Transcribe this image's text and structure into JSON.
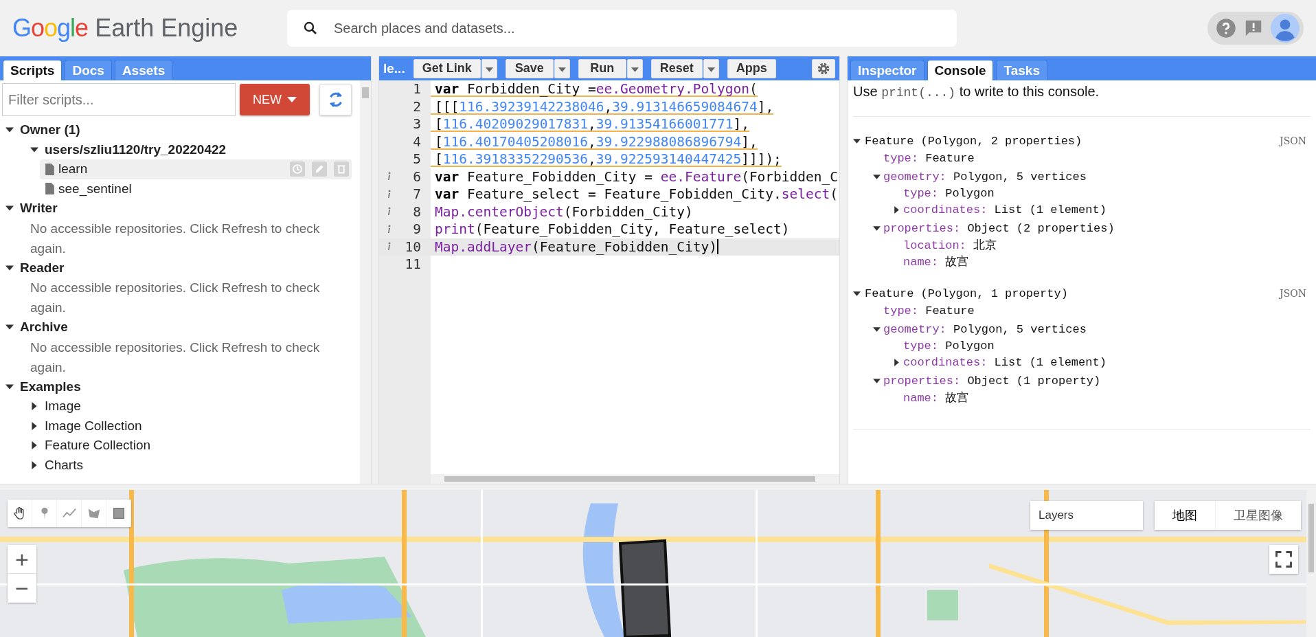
{
  "header": {
    "logo": {
      "brand": "Google",
      "product": "Earth Engine"
    },
    "search": {
      "placeholder": "Search places and datasets..."
    }
  },
  "left_panel": {
    "tabs": [
      {
        "label": "Scripts",
        "selected": true
      },
      {
        "label": "Docs",
        "selected": false
      },
      {
        "label": "Assets",
        "selected": false
      }
    ],
    "filter": {
      "placeholder": "Filter scripts..."
    },
    "new_button": "NEW",
    "tree": [
      {
        "label": "Owner (1)",
        "expanded": true,
        "children": [
          {
            "label": "users/szliu1120/try_20220422",
            "expanded": true,
            "children": [
              {
                "label": "learn",
                "kind": "file",
                "selected": true
              },
              {
                "label": "see_sentinel",
                "kind": "file",
                "selected": false
              }
            ]
          }
        ]
      },
      {
        "label": "Writer",
        "expanded": true,
        "message": "No accessible repositories. Click Refresh to check again."
      },
      {
        "label": "Reader",
        "expanded": true,
        "message": "No accessible repositories. Click Refresh to check again."
      },
      {
        "label": "Archive",
        "expanded": true,
        "message": "No accessible repositories. Click Refresh to check again."
      },
      {
        "label": "Examples",
        "expanded": true,
        "children": [
          {
            "label": "Image",
            "kind": "folder",
            "expanded": false
          },
          {
            "label": "Image Collection",
            "kind": "folder",
            "expanded": false
          },
          {
            "label": "Feature Collection",
            "kind": "folder",
            "expanded": false
          },
          {
            "label": "Charts",
            "kind": "folder",
            "expanded": false
          }
        ]
      }
    ]
  },
  "editor": {
    "title": "le...",
    "buttons": [
      {
        "label": "Get Link",
        "dropdown": true
      },
      {
        "label": "Save",
        "dropdown": true
      },
      {
        "label": "Run",
        "dropdown": true
      },
      {
        "label": "Reset",
        "dropdown": true
      },
      {
        "label": "Apps",
        "dropdown": false
      }
    ],
    "lines": [
      {
        "number": "1",
        "warning": true,
        "info": false,
        "current": false,
        "tokens": [
          {
            "kind": "kw",
            "text": "var"
          },
          {
            "kind": "plain",
            "text": " Forbidden_City ="
          },
          {
            "kind": "fn",
            "text": "ee.Geometry.Polygon"
          },
          {
            "kind": "plain",
            "text": "("
          }
        ]
      },
      {
        "number": "2",
        "warning": true,
        "info": false,
        "current": false,
        "tokens": [
          {
            "kind": "plain",
            "text": "[[["
          },
          {
            "kind": "num",
            "text": "116.39239142238046"
          },
          {
            "kind": "plain",
            "text": ","
          },
          {
            "kind": "num",
            "text": "39.913146659084674"
          },
          {
            "kind": "plain",
            "text": "],"
          }
        ]
      },
      {
        "number": "3",
        "warning": true,
        "info": false,
        "current": false,
        "tokens": [
          {
            "kind": "plain",
            "text": "["
          },
          {
            "kind": "num",
            "text": "116.40209029017831"
          },
          {
            "kind": "plain",
            "text": ","
          },
          {
            "kind": "num",
            "text": "39.91354166001771"
          },
          {
            "kind": "plain",
            "text": "],"
          }
        ]
      },
      {
        "number": "4",
        "warning": true,
        "info": false,
        "current": false,
        "tokens": [
          {
            "kind": "plain",
            "text": "["
          },
          {
            "kind": "num",
            "text": "116.40170405208016"
          },
          {
            "kind": "plain",
            "text": ","
          },
          {
            "kind": "num",
            "text": "39.922988086896794"
          },
          {
            "kind": "plain",
            "text": "],"
          }
        ]
      },
      {
        "number": "5",
        "warning": true,
        "info": false,
        "current": false,
        "tokens": [
          {
            "kind": "plain",
            "text": "["
          },
          {
            "kind": "num",
            "text": "116.39183352290536"
          },
          {
            "kind": "plain",
            "text": ","
          },
          {
            "kind": "num",
            "text": "39.922593140447425"
          },
          {
            "kind": "plain",
            "text": "]]]);"
          }
        ]
      },
      {
        "number": "6",
        "warning": false,
        "info": true,
        "current": false,
        "tokens": [
          {
            "kind": "kw",
            "text": "var"
          },
          {
            "kind": "plain",
            "text": " Feature_Fobidden_City = "
          },
          {
            "kind": "fn",
            "text": "ee.Feature"
          },
          {
            "kind": "plain",
            "text": "(Forbidden_C"
          }
        ]
      },
      {
        "number": "7",
        "warning": false,
        "info": true,
        "current": false,
        "tokens": [
          {
            "kind": "kw",
            "text": "var"
          },
          {
            "kind": "plain",
            "text": " Feature_select = Feature_Fobidden_City."
          },
          {
            "kind": "fn",
            "text": "select"
          },
          {
            "kind": "plain",
            "text": "("
          }
        ]
      },
      {
        "number": "8",
        "warning": false,
        "info": true,
        "current": false,
        "tokens": [
          {
            "kind": "fn",
            "text": "Map.centerObject"
          },
          {
            "kind": "plain",
            "text": "(Forbidden_City)"
          }
        ]
      },
      {
        "number": "9",
        "warning": false,
        "info": true,
        "current": false,
        "tokens": [
          {
            "kind": "fn",
            "text": "print"
          },
          {
            "kind": "plain",
            "text": "(Feature_Fobidden_City, Feature_select)"
          }
        ]
      },
      {
        "number": "10",
        "warning": false,
        "info": true,
        "current": true,
        "tokens": [
          {
            "kind": "fn",
            "text": "Map.addLayer"
          },
          {
            "kind": "plain",
            "text": "(Feature_Fobidden_City)"
          }
        ]
      },
      {
        "number": "11",
        "info": false,
        "current": false
      }
    ]
  },
  "right_panel": {
    "tabs": [
      {
        "label": "Inspector",
        "selected": false
      },
      {
        "label": "Console",
        "selected": true
      },
      {
        "label": "Tasks",
        "selected": false
      }
    ],
    "hint": {
      "before": "Use",
      "code": "print(...)",
      "after": "to write to this console."
    },
    "outputs": [
      {
        "label": "Feature (Polygon, 2 properties)",
        "link": "JSON",
        "expanded": true,
        "children": [
          {
            "key": "type:",
            "value": "Feature"
          },
          {
            "key": "geometry:",
            "value": "Polygon, 5 vertices",
            "expanded": true,
            "children": [
              {
                "key": "type:",
                "value": "Polygon"
              },
              {
                "key": "coordinates:",
                "value": "List (1 element)",
                "expanded": false
              }
            ]
          },
          {
            "key": "properties:",
            "value": "Object (2 properties)",
            "expanded": true,
            "children": [
              {
                "key": "location:",
                "value": "北京"
              },
              {
                "key": "name:",
                "value": "故宫"
              }
            ]
          }
        ]
      },
      {
        "label": "Feature (Polygon, 1 property)",
        "link": "JSON",
        "expanded": true,
        "children": [
          {
            "key": "type:",
            "value": "Feature"
          },
          {
            "key": "geometry:",
            "value": "Polygon, 5 vertices",
            "expanded": true,
            "children": [
              {
                "key": "type:",
                "value": "Polygon"
              },
              {
                "key": "coordinates:",
                "value": "List (1 element)",
                "expanded": false
              }
            ]
          },
          {
            "key": "properties:",
            "value": "Object (1 property)",
            "expanded": true,
            "children": [
              {
                "key": "name:",
                "value": "故宫"
              }
            ]
          }
        ]
      }
    ]
  },
  "map": {
    "kind": "picture",
    "layers_button": "Layers",
    "map_types": [
      {
        "label": "地图",
        "selected": true
      },
      {
        "label": "卫星图像",
        "selected": false
      }
    ],
    "zoom_in": "+",
    "zoom_out": "−"
  }
}
